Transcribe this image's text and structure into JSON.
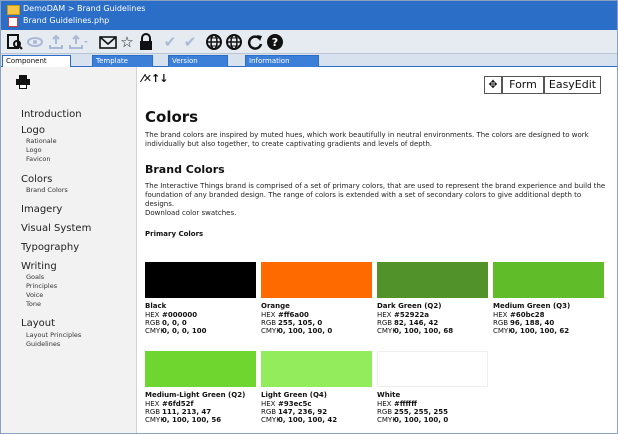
{
  "window": {
    "breadcrumb": "DemoDAM > Brand Guidelines",
    "filename": "Brand Guidelines.php"
  },
  "toolbar": {
    "icons": [
      "view-icon",
      "eye-icon",
      "upload-icon",
      "upload-dropdown-icon",
      "mail-icon",
      "star-icon",
      "lock-icon",
      "check-icon",
      "approve-dropdown-icon",
      "globe-icon",
      "globe-settings-icon",
      "refresh-icon",
      "help-icon"
    ]
  },
  "tabs": [
    "Component",
    "Template",
    "Version",
    "Information"
  ],
  "sidebar": {
    "sections": [
      {
        "label": "Introduction",
        "items": []
      },
      {
        "label": "Logo",
        "items": [
          "Rationale",
          "Logo",
          "Favicon"
        ]
      },
      {
        "label": "Colors",
        "items": [
          "Brand Colors"
        ]
      },
      {
        "label": "Imagery",
        "items": []
      },
      {
        "label": "Visual System",
        "items": []
      },
      {
        "label": "Typography",
        "items": []
      },
      {
        "label": "Writing",
        "items": [
          "Goals",
          "Principles",
          "Voice",
          "Tone"
        ]
      },
      {
        "label": "Layout",
        "items": [
          "Layout Principles",
          "Guidelines"
        ]
      }
    ]
  },
  "editor": {
    "tools": "⁄✕↑↓",
    "form_label": "Form",
    "easyedit_label": "EasyEdit"
  },
  "content": {
    "title": "Colors",
    "intro": "The brand colors are inspired by muted hues, which work beautifully in neutral environments. The colors are designed to work individually but also together, to create captivating gradients and levels of depth.",
    "subtitle": "Brand Colors",
    "body": "The Interactive Things brand is comprised of a set of primary colors, that are used to represent the brand experience and build the foundation of any branded design. The range of colors is extended with a set of secondary colors to give additional depth to designs.",
    "download": "Download color swatches.",
    "primary_heading": "Primary Colors",
    "swatches": [
      {
        "name": "Black",
        "hex": "#000000",
        "rgb": "0, 0, 0",
        "cmyk": "0, 0, 0, 100",
        "color": "#000000"
      },
      {
        "name": "Orange",
        "hex": "#ff6a00",
        "rgb": "255, 105, 0",
        "cmyk": "0, 100, 100, 0",
        "color": "#ff6a00"
      },
      {
        "name": "Dark Green (Q2)",
        "hex": "#52922a",
        "rgb": "82, 146, 42",
        "cmyk": "0, 100, 100, 68",
        "color": "#52922a"
      },
      {
        "name": "Medium Green (Q3)",
        "hex": "#60bc28",
        "rgb": "96, 188, 40",
        "cmyk": "0, 100, 100, 62",
        "color": "#60bc28"
      },
      {
        "name": "Medium-Light Green (Q2)",
        "hex": "#6fd52f",
        "rgb": "111, 213, 47",
        "cmyk": "0, 100, 100, 56",
        "color": "#6fd52f"
      },
      {
        "name": "Light Green (Q4)",
        "hex": "#93ec5c",
        "rgb": "147, 236, 92",
        "cmyk": "0, 100, 100, 42",
        "color": "#93ec5c"
      },
      {
        "name": "White",
        "hex": "#ffffff",
        "rgb": "255, 255, 255",
        "cmyk": "0, 100, 100, 0",
        "color": "#ffffff"
      }
    ],
    "labels": {
      "hex": "HEX",
      "rgb": "RGB",
      "cmyk": "CMYK"
    }
  }
}
